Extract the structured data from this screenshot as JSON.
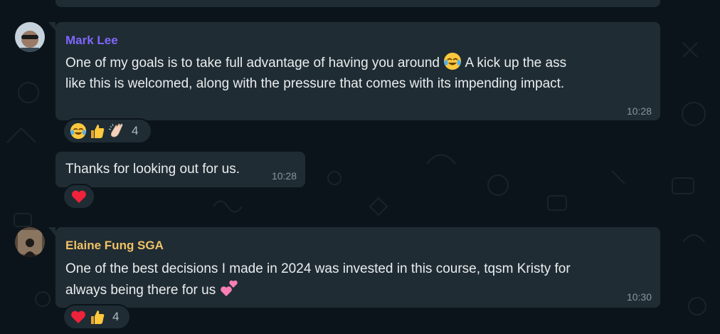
{
  "messages": [
    {
      "sender": "Mark Lee",
      "sender_color": "#7f66ff",
      "text_line1_a": "One of my goals is to take full advantage of having you around",
      "text_line1_b": "A kick up the ass",
      "text_line2": "like this is welcomed, along with the pressure that comes with its impending impact.",
      "inline_emoji": "face-with-tears-of-joy-icon",
      "time": "10:28",
      "reactions": [
        "face-with-tears-of-joy-icon",
        "thumbs-up-icon",
        "clapping-hands-icon"
      ],
      "reaction_count": "4"
    },
    {
      "text": "Thanks for looking out for us.",
      "time": "10:28",
      "reactions": [
        "red-heart-icon"
      ]
    },
    {
      "sender": "Elaine Fung SGA",
      "sender_color": "#f0c266",
      "text_line1": "One of the best decisions I made in 2024 was invested in this course, tqsm Kristy for",
      "text_line2": "always being there for us",
      "inline_emoji": "two-hearts-icon",
      "time": "10:30",
      "reactions": [
        "red-heart-icon",
        "thumbs-up-icon"
      ],
      "reaction_count": "4"
    }
  ],
  "colors": {
    "background": "#0b141a",
    "bubble": "#202c33",
    "time": "#8696a0"
  }
}
